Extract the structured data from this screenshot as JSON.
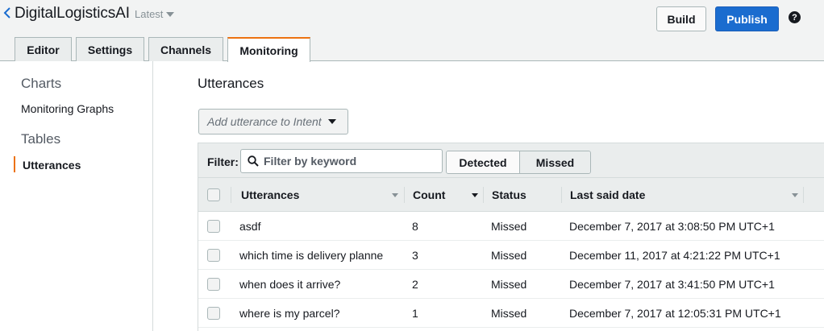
{
  "header": {
    "bot_name": "DigitalLogisticsAI",
    "version": "Latest",
    "build_label": "Build",
    "publish_label": "Publish",
    "help_label": "?"
  },
  "tabs": [
    {
      "label": "Editor",
      "active": false
    },
    {
      "label": "Settings",
      "active": false
    },
    {
      "label": "Channels",
      "active": false
    },
    {
      "label": "Monitoring",
      "active": true
    }
  ],
  "sidebar": {
    "charts_heading": "Charts",
    "charts_items": [
      {
        "label": "Monitoring Graphs"
      }
    ],
    "tables_heading": "Tables",
    "tables_items": [
      {
        "label": "Utterances",
        "active": true
      }
    ]
  },
  "main": {
    "title": "Utterances",
    "add_utterance_label": "Add utterance to Intent",
    "filter": {
      "label": "Filter:",
      "placeholder": "Filter by keyword",
      "value": ""
    },
    "segments": [
      {
        "label": "Detected",
        "selected": false
      },
      {
        "label": "Missed",
        "selected": true
      }
    ],
    "table": {
      "columns": [
        "Utterances",
        "Count",
        "Status",
        "Last said date"
      ],
      "rows": [
        {
          "utterance": "asdf",
          "count": "8",
          "status": "Missed",
          "date": "December 7, 2017 at 3:08:50 PM UTC+1"
        },
        {
          "utterance": "which time is delivery planne",
          "count": "3",
          "status": "Missed",
          "date": "December 11, 2017 at 4:21:22 PM UTC+1"
        },
        {
          "utterance": "when does it arrive?",
          "count": "2",
          "status": "Missed",
          "date": "December 7, 2017 at 3:41:50 PM UTC+1"
        },
        {
          "utterance": "where is my parcel?",
          "count": "1",
          "status": "Missed",
          "date": "December 7, 2017 at 12:05:31 PM UTC+1"
        }
      ]
    }
  },
  "colors": {
    "accent": "#ec7211",
    "primary_button": "#1a6ccf",
    "chrome_bg": "#f2f3f3"
  }
}
